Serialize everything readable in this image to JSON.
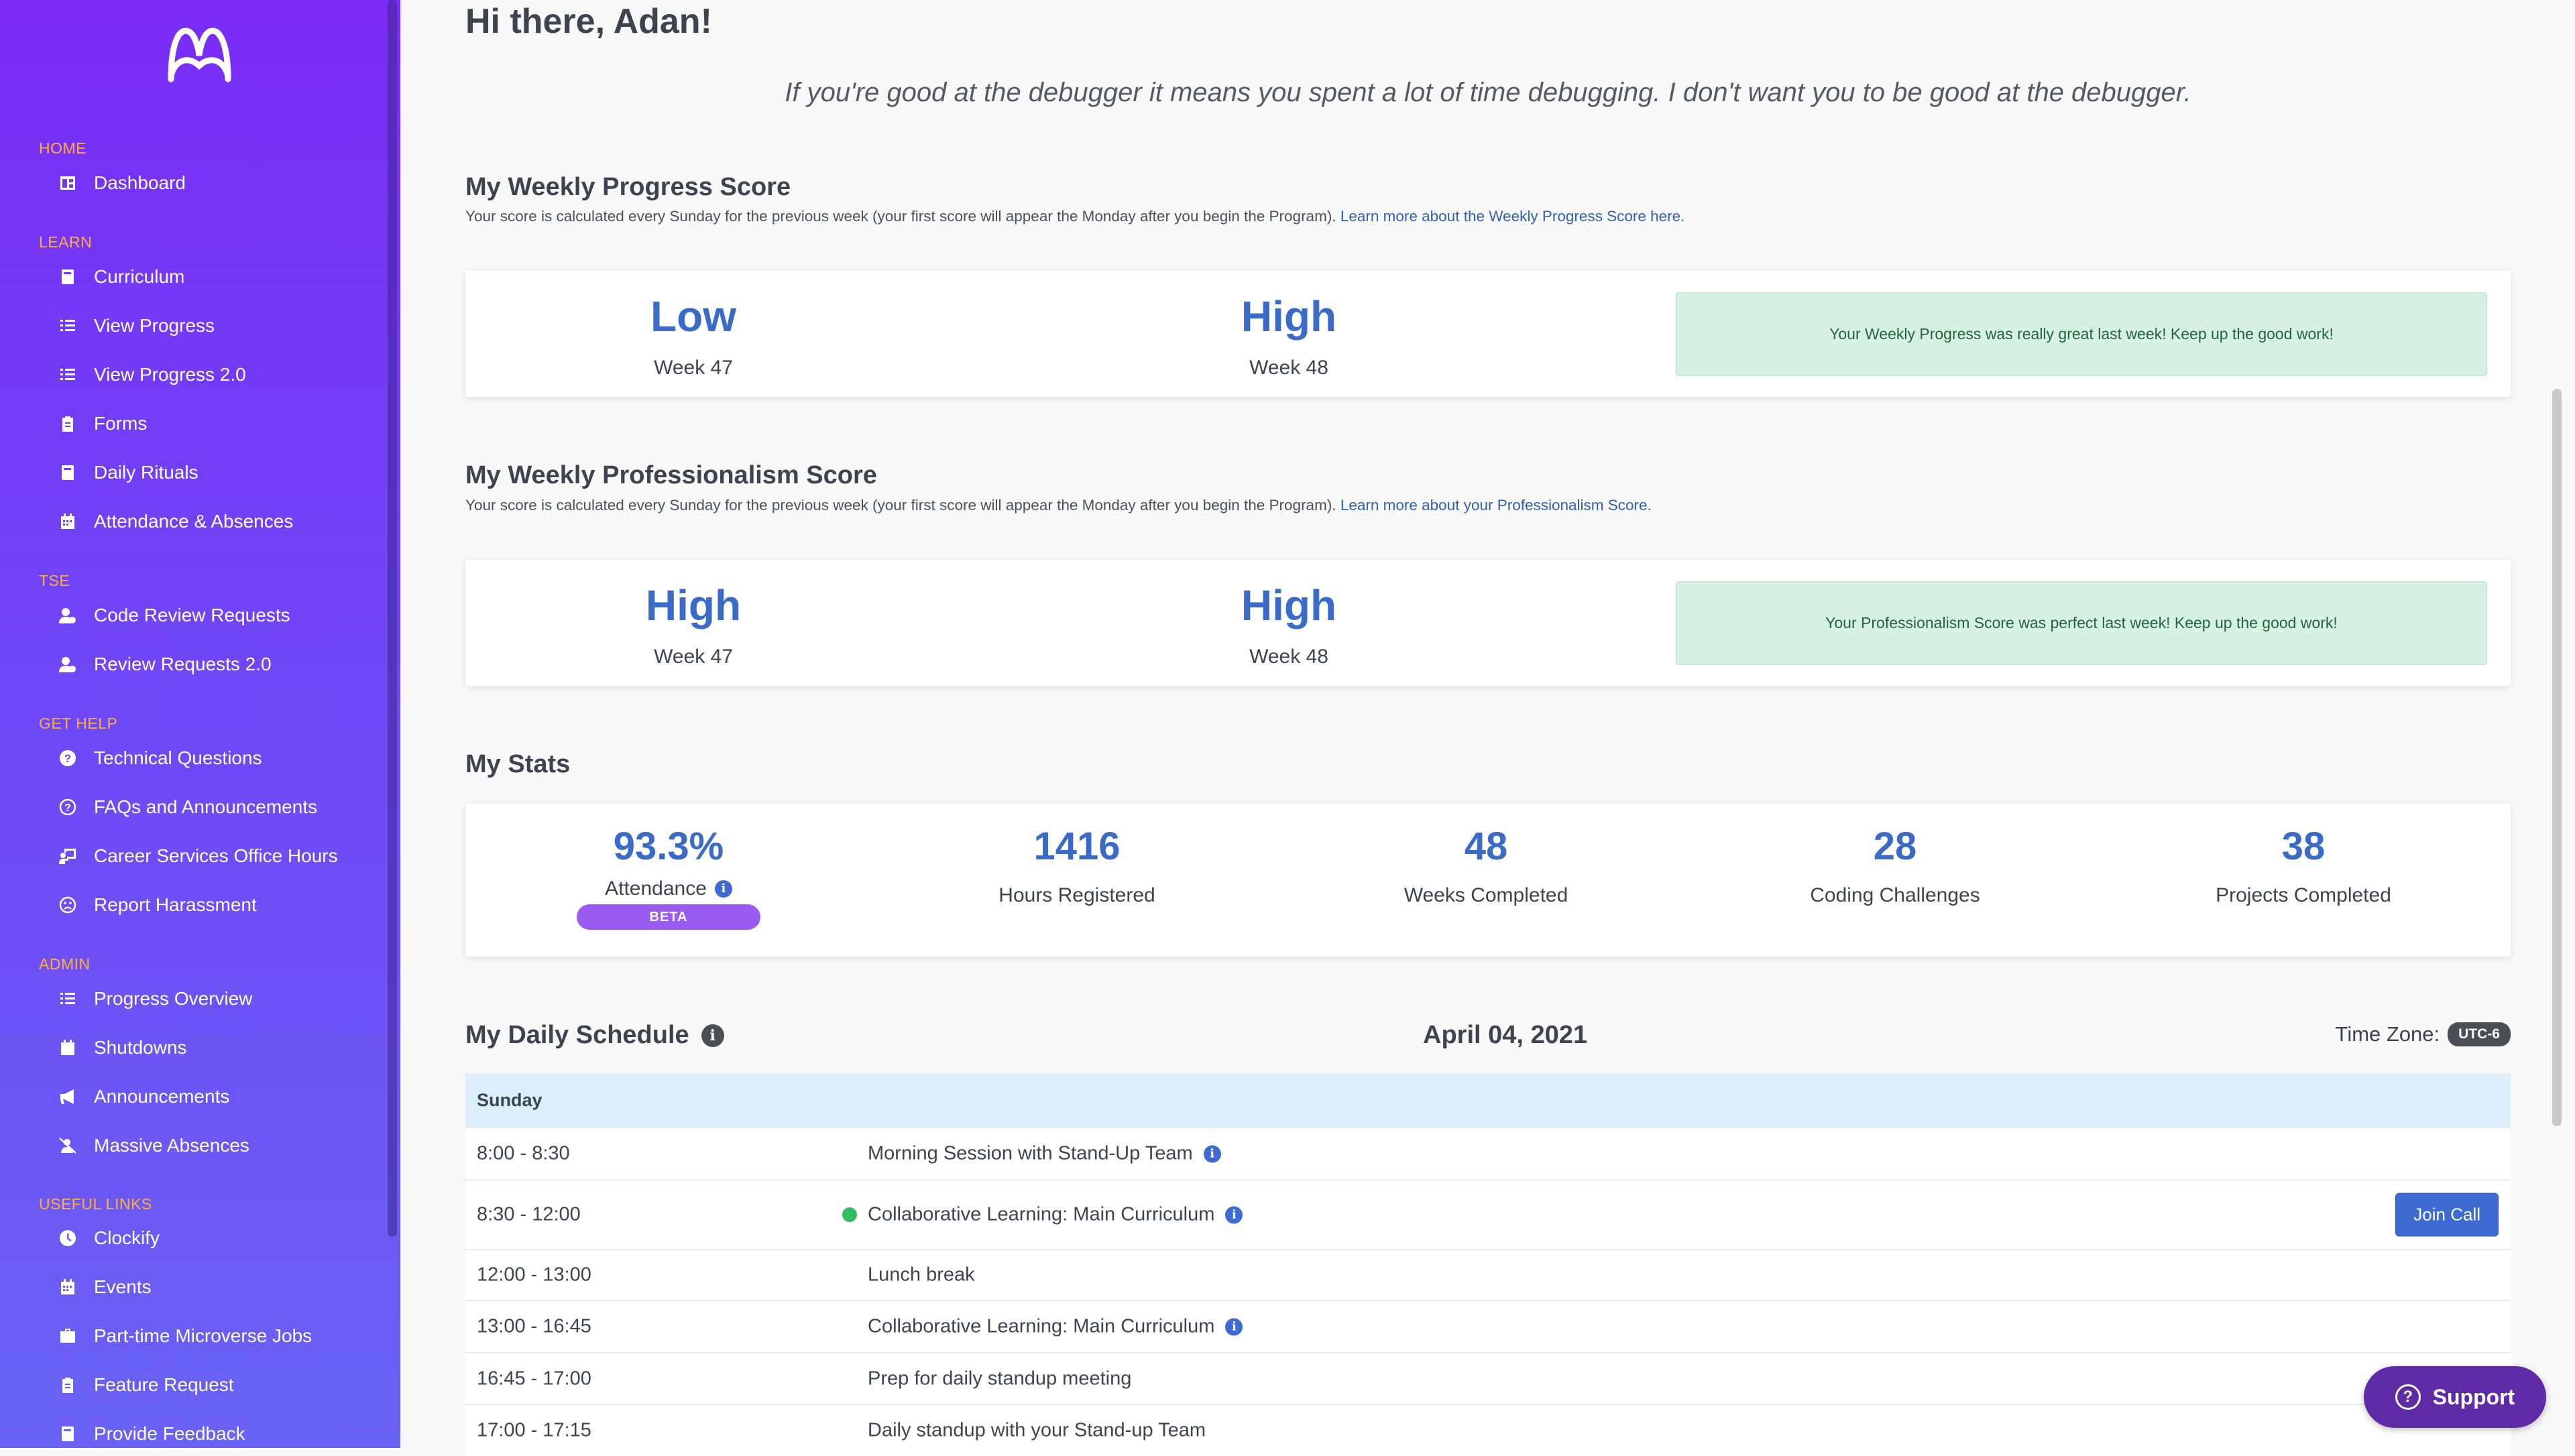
{
  "sidebar": {
    "sections": [
      {
        "label": "HOME",
        "items": [
          {
            "label": "Dashboard",
            "icon": "dashboard-icon"
          }
        ]
      },
      {
        "label": "LEARN",
        "items": [
          {
            "label": "Curriculum",
            "icon": "book-icon"
          },
          {
            "label": "View Progress",
            "icon": "list-icon"
          },
          {
            "label": "View Progress 2.0",
            "icon": "list-icon"
          },
          {
            "label": "Forms",
            "icon": "clipboard-icon"
          },
          {
            "label": "Daily Rituals",
            "icon": "book-icon"
          },
          {
            "label": "Attendance & Absences",
            "icon": "calendar-icon"
          }
        ]
      },
      {
        "label": "TSE",
        "items": [
          {
            "label": "Code Review Requests",
            "icon": "user-gear-icon"
          },
          {
            "label": "Review Requests 2.0",
            "icon": "user-gear-icon"
          }
        ]
      },
      {
        "label": "GET HELP",
        "items": [
          {
            "label": "Technical Questions",
            "icon": "question-circle-icon"
          },
          {
            "label": "FAQs and Announcements",
            "icon": "question-outline-icon"
          },
          {
            "label": "Career Services Office Hours",
            "icon": "person-board-icon"
          },
          {
            "label": "Report Harassment",
            "icon": "frown-icon"
          }
        ]
      },
      {
        "label": "ADMIN",
        "items": [
          {
            "label": "Progress Overview",
            "icon": "list-icon"
          },
          {
            "label": "Shutdowns",
            "icon": "calendar-x-icon"
          },
          {
            "label": "Announcements",
            "icon": "megaphone-icon"
          },
          {
            "label": "Massive Absences",
            "icon": "user-slash-icon"
          }
        ]
      },
      {
        "label": "USEFUL LINKS",
        "items": [
          {
            "label": "Clockify",
            "icon": "clock-icon"
          },
          {
            "label": "Events",
            "icon": "calendar-icon"
          },
          {
            "label": "Part-time Microverse Jobs",
            "icon": "briefcase-icon"
          },
          {
            "label": "Feature Request",
            "icon": "clipboard-icon"
          },
          {
            "label": "Provide Feedback",
            "icon": "book-icon"
          }
        ]
      }
    ]
  },
  "greeting": "Hi there, Adan!",
  "quote": "If you're good at the debugger it means you spent a lot of time debugging. I don't want you to be good at the debugger.",
  "progress": {
    "title": "My Weekly Progress Score",
    "desc": "Your score is calculated every Sunday for the previous week (your first score will appear the Monday after you begin the Program). ",
    "link": "Learn more about the Weekly Progress Score here.",
    "scores": [
      {
        "level": "Low",
        "week": "Week 47"
      },
      {
        "level": "High",
        "week": "Week 48"
      }
    ],
    "message": "Your Weekly Progress was really great last week! Keep up the good work!"
  },
  "professionalism": {
    "title": "My Weekly Professionalism Score",
    "desc": "Your score is calculated every Sunday for the previous week (your first score will appear the Monday after you begin the Program). ",
    "link": "Learn more about your Professionalism Score.",
    "scores": [
      {
        "level": "High",
        "week": "Week 47"
      },
      {
        "level": "High",
        "week": "Week 48"
      }
    ],
    "message": "Your Professionalism Score was perfect last week! Keep up the good work!"
  },
  "stats": {
    "title": "My Stats",
    "items": [
      {
        "value": "93.3%",
        "label": "Attendance",
        "badge": "BETA"
      },
      {
        "value": "1416",
        "label": "Hours Registered"
      },
      {
        "value": "48",
        "label": "Weeks Completed"
      },
      {
        "value": "28",
        "label": "Coding Challenges"
      },
      {
        "value": "38",
        "label": "Projects Completed"
      }
    ]
  },
  "schedule": {
    "title": "My Daily Schedule",
    "date": "April 04, 2021",
    "timezone_label": "Time Zone:",
    "timezone": "UTC-6",
    "day": "Sunday",
    "join_label": "Join Call",
    "live_color": "#2fbf62",
    "rows": [
      {
        "time": "8:00 - 8:30",
        "title": "Morning Session with Stand-Up Team"
      },
      {
        "time": "8:30 - 12:00",
        "title": "Collaborative Learning: Main Curriculum"
      },
      {
        "time": "12:00 - 13:00",
        "title": "Lunch break"
      },
      {
        "time": "13:00 - 16:45",
        "title": "Collaborative Learning: Main Curriculum"
      },
      {
        "time": "16:45 - 17:00",
        "title": "Prep for daily standup meeting"
      },
      {
        "time": "17:00 - 17:15",
        "title": "Daily standup with your Stand-up Team"
      }
    ]
  },
  "support_label": "Support",
  "colors": {
    "accent": "#3a6bc8",
    "sidebar_top": "#7a2cf6",
    "section_label": "#ffae3d",
    "success_bg": "#d7f2e3"
  }
}
